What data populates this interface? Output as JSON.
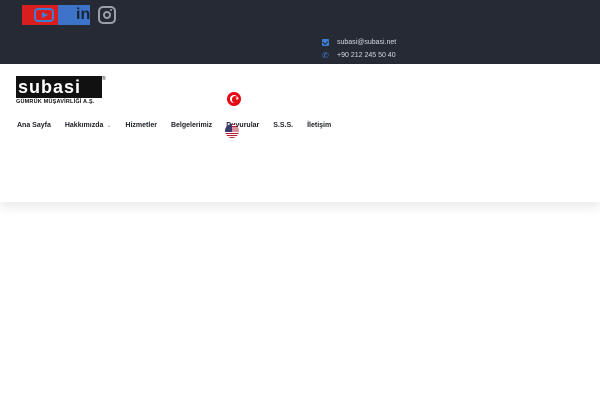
{
  "topbar": {
    "social": [
      {
        "name": "youtube",
        "icon": "youtube-icon"
      },
      {
        "name": "linkedin",
        "icon": "linkedin-icon",
        "text": "in"
      },
      {
        "name": "instagram",
        "icon": "instagram-icon"
      }
    ],
    "email": "subasi@subasi.net",
    "phone": "+90 212 245 50 40"
  },
  "logo": {
    "word": "subasi",
    "tagline": "GÜMRÜK MÜŞAVİRLİĞİ A.Ş.",
    "reg": "®"
  },
  "nav": {
    "items": [
      {
        "label": "Ana Sayfa",
        "dropdown": false
      },
      {
        "label": "Hakkımızda",
        "dropdown": true
      },
      {
        "label": "Hizmetler",
        "dropdown": false
      },
      {
        "label": "Belgelerimiz",
        "dropdown": false
      },
      {
        "label": "Duyurular",
        "dropdown": false
      },
      {
        "label": "S.S.S.",
        "dropdown": false
      },
      {
        "label": "İletişim",
        "dropdown": false
      }
    ],
    "chevron": "⌄"
  },
  "languages": [
    {
      "code": "tr",
      "icon": "turkey-flag-icon"
    },
    {
      "code": "en",
      "icon": "usa-flag-icon"
    }
  ],
  "colors": {
    "topbar_bg": "#262a35",
    "accent": "#3d7fd6",
    "text_dark": "#1a1d24"
  }
}
